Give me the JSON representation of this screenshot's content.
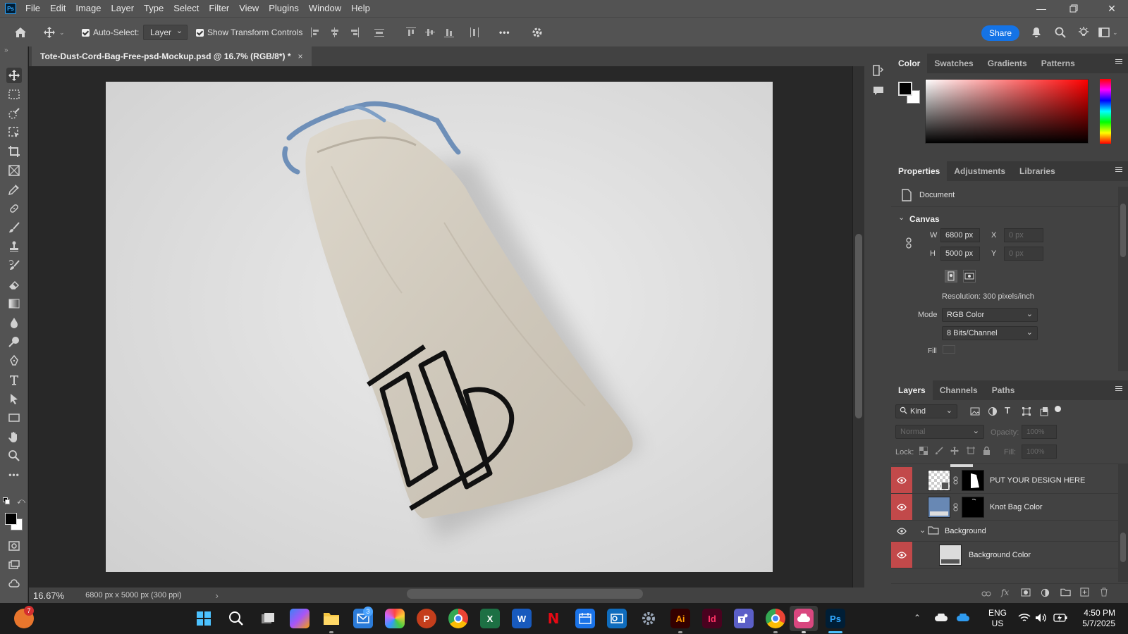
{
  "menubar": {
    "logo": "Ps",
    "items": [
      "File",
      "Edit",
      "Image",
      "Layer",
      "Type",
      "Select",
      "Filter",
      "View",
      "Plugins",
      "Window",
      "Help"
    ]
  },
  "options": {
    "auto_select_label": "Auto-Select:",
    "auto_select_value": "Layer",
    "transform_label": "Show Transform Controls",
    "share_label": "Share",
    "more_label": "•••"
  },
  "document": {
    "tab_title": "Tote-Dust-Cord-Bag-Free-psd-Mockup.psd @ 16.7% (RGB/8*) *",
    "close_glyph": "×"
  },
  "status": {
    "zoom": "16.67%",
    "doc_info": "6800 px x 5000 px (300 ppi)",
    "arrow": "›"
  },
  "color_panel": {
    "tabs": [
      "Color",
      "Swatches",
      "Gradients",
      "Patterns"
    ],
    "active_tab": "Color",
    "foreground": "#000000",
    "background": "#ffffff",
    "hue": "#ff0000"
  },
  "properties_panel": {
    "tabs": [
      "Properties",
      "Adjustments",
      "Libraries"
    ],
    "active_tab": "Properties",
    "doc_label": "Document",
    "section": "Canvas",
    "w_label": "W",
    "w_value": "6800 px",
    "h_label": "H",
    "h_value": "5000 px",
    "x_label": "X",
    "x_value": "0 px",
    "y_label": "Y",
    "y_value": "0 px",
    "resolution": "Resolution: 300 pixels/inch",
    "mode_label": "Mode",
    "mode_value": "RGB Color",
    "depth_value": "8 Bits/Channel",
    "fill_label": "Fill"
  },
  "layers_panel": {
    "tabs": [
      "Layers",
      "Channels",
      "Paths"
    ],
    "active_tab": "Layers",
    "filter_label": "Kind",
    "blend_mode": "Normal",
    "opacity_label": "Opacity:",
    "opacity_value": "100%",
    "lock_label": "Lock:",
    "fill_label": "Fill:",
    "fill_value": "100%",
    "layers": [
      {
        "name": "PUT YOUR DESIGN HERE"
      },
      {
        "name": "Knot Bag Color"
      },
      {
        "name": "Background"
      },
      {
        "name": "Background Color"
      }
    ]
  },
  "taskbar": {
    "lang_top": "ENG",
    "lang_bottom": "US",
    "time": "4:50 PM",
    "date": "5/7/2025",
    "badge_mail": "3",
    "badge_app": "7",
    "apps": [
      "P",
      "X",
      "W",
      "N",
      "Ai",
      "Id",
      "Ps"
    ]
  }
}
